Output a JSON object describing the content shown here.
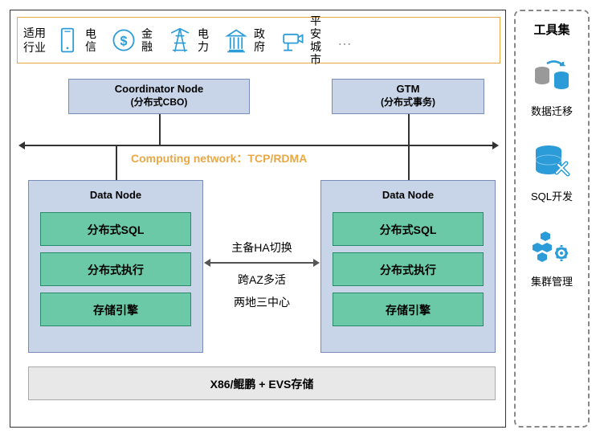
{
  "industry": {
    "label": "适用\n行业",
    "items": [
      {
        "name": "电信"
      },
      {
        "name": "金融"
      },
      {
        "name": "电力"
      },
      {
        "name": "政府"
      },
      {
        "name": "平安\n城市"
      }
    ],
    "more": "…"
  },
  "coordinator": {
    "title": "Coordinator Node",
    "sub": "(分布式CBO)"
  },
  "gtm": {
    "title": "GTM",
    "sub": "(分布式事务)"
  },
  "network": "Computing network：TCP/RDMA",
  "dataNode": {
    "title": "Data Node",
    "boxes": [
      "分布式SQL",
      "分布式执行",
      "存储引擎"
    ]
  },
  "middle": {
    "line1": "主备HA切换",
    "line2": "跨AZ多活",
    "line3": "两地三中心"
  },
  "storage": "X86/鲲鹏 + EVS存储",
  "tools": {
    "title": "工具集",
    "items": [
      "数据迁移",
      "SQL开发",
      "集群管理"
    ]
  }
}
